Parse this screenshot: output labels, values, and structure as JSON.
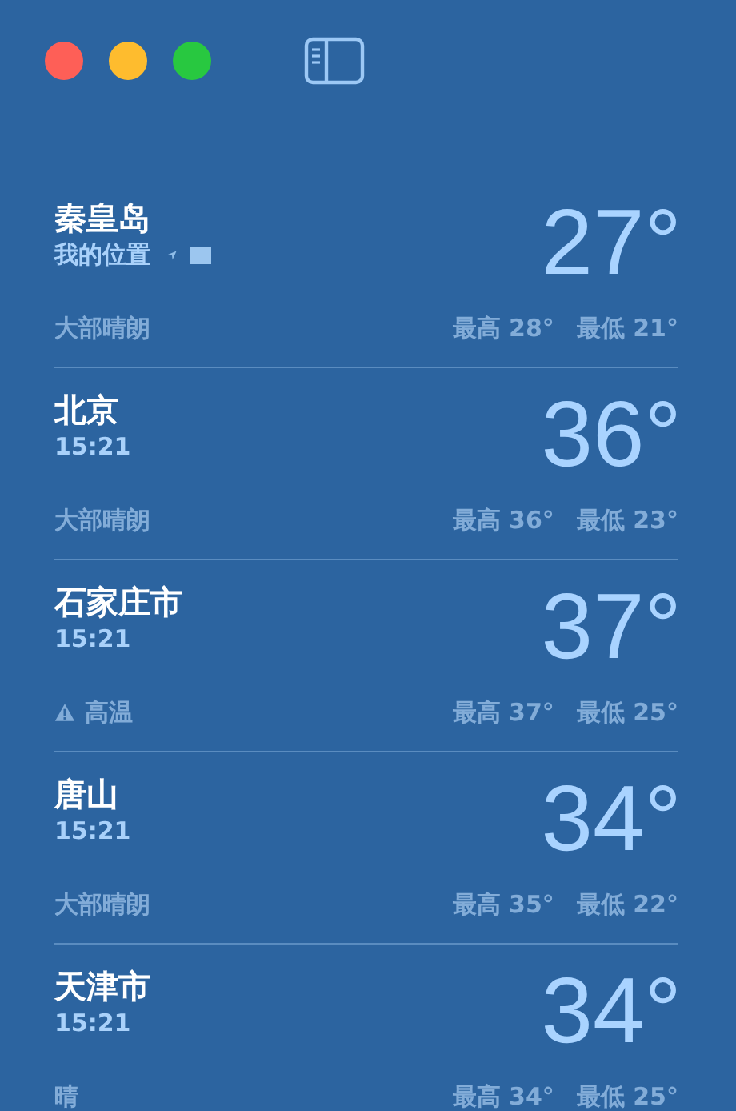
{
  "window": {
    "controls": [
      {
        "kind": "close"
      },
      {
        "kind": "minimize"
      },
      {
        "kind": "zoom"
      }
    ]
  },
  "locations": [
    {
      "name": "秦皇岛",
      "subtitle": "我的位置",
      "current": true,
      "temperature": "27°",
      "condition": "大部晴朗",
      "warning": false,
      "high": "最高 28°",
      "low": "最低 21°"
    },
    {
      "name": "北京",
      "subtitle": "15:21",
      "current": false,
      "temperature": "36°",
      "condition": "大部晴朗",
      "warning": false,
      "high": "最高 36°",
      "low": "最低 23°"
    },
    {
      "name": "石家庄市",
      "subtitle": "15:21",
      "current": false,
      "temperature": "37°",
      "condition": "高温",
      "warning": true,
      "high": "最高 37°",
      "low": "最低 25°"
    },
    {
      "name": "唐山",
      "subtitle": "15:21",
      "current": false,
      "temperature": "34°",
      "condition": "大部晴朗",
      "warning": false,
      "high": "最高 35°",
      "low": "最低 22°"
    },
    {
      "name": "天津市",
      "subtitle": "15:21",
      "current": false,
      "temperature": "34°",
      "condition": "晴",
      "warning": false,
      "high": "最高 34°",
      "low": "最低 25°"
    }
  ]
}
